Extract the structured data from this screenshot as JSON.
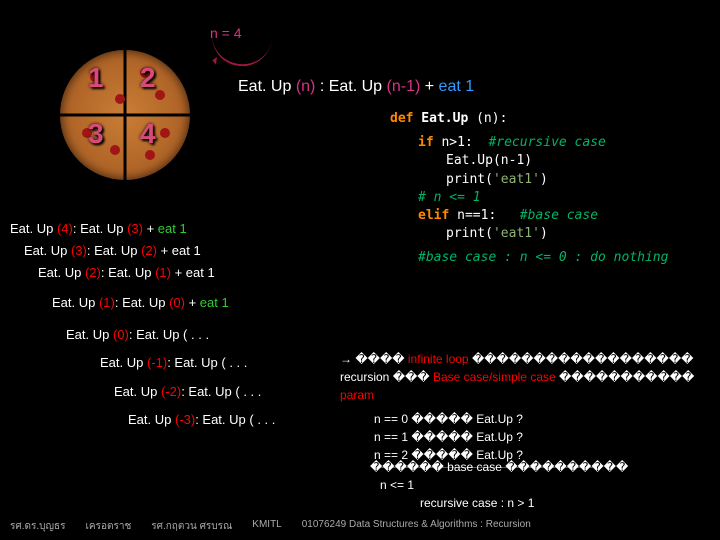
{
  "header": {
    "n_label": "n = 4"
  },
  "formula": {
    "lead": "Eat. Up ",
    "n": "(n)",
    "colon": " : ",
    "call": "Eat. Up ",
    "nminus": "(n-1)",
    "plus": " + ",
    "eat1": "eat 1"
  },
  "pizza": {
    "q1": "1",
    "q2": "2",
    "q3": "3",
    "q4": "4"
  },
  "code": {
    "l1a": "def",
    "l1b": " Eat.Up ",
    "l1c": "(n):",
    "l2a": "if",
    "l2b": " n>1:  ",
    "l2c": "#recursive case",
    "l3": "Eat.Up(n-1)",
    "l4a": "print(",
    "l4b": "'eat1'",
    "l4c": ")",
    "l5": "# n <= 1",
    "l6a": "elif",
    "l6b": " n==1:   ",
    "l6c": "#base case",
    "l7a": "print(",
    "l7b": "'eat1'",
    "l7c": ")",
    "l8": "#base case : n <= 0 : do nothing"
  },
  "trace": {
    "t0a": "Eat. Up ",
    "t0n": "(4)",
    "t0b": ": Eat. Up ",
    "t0m": "(3)",
    "t0c": " + ",
    "t0e": "eat 1",
    "t1a": "Eat. Up ",
    "t1n": "(3)",
    "t1b": ": Eat. Up ",
    "t1m": "(2)",
    "t1c": " + eat 1",
    "t2a": "Eat. Up ",
    "t2n": "(2)",
    "t2b": ": Eat. Up ",
    "t2m": "(1)",
    "t2c": " + eat 1",
    "t3a": "Eat. Up ",
    "t3n": "(1)",
    "t3b": ": Eat. Up ",
    "t3m": "(0)",
    "t3c": " + ",
    "t3e": "eat 1",
    "t4a": "Eat. Up ",
    "t4n": "(0)",
    "t4b": ": Eat. Up ( . . .",
    "t5a": "Eat. Up ",
    "t5n": "(-1)",
    "t5b": ": Eat. Up ( . . .",
    "t6a": "Eat. Up ",
    "t6n": "(-2)",
    "t6b": ": Eat. Up ( . . .",
    "t7a": "Eat. Up ",
    "t7n": "(-3)",
    "t7b": ": Eat. Up ( . . ."
  },
  "notes": {
    "r1a": "→ ���� ",
    "r1b": "infinite loop",
    "r1c": " ������������������",
    "r2a": "recursion ��� ",
    "r2b": "Base case/simple case",
    "r2c": " ����������� ",
    "r2d": "param",
    "r3": "n == 0  ����� Eat.Up ?",
    "r4": "n == 1  ����� Eat.Up ?",
    "r5": "n == 2  ����� Eat.Up ?"
  },
  "summary": {
    "s1": "������ base case ����������",
    "s2": "n <= 1",
    "s3": "recursive case :  n  > 1"
  },
  "footer": {
    "f1": "รศ.ดร.บุญธร",
    "f2": "เครอตราช",
    "f3": "รศ.กฤตวน  ศรบรณ",
    "f4": "KMITL",
    "f5": "01076249 Data Structures & Algorithms : Recursion"
  }
}
